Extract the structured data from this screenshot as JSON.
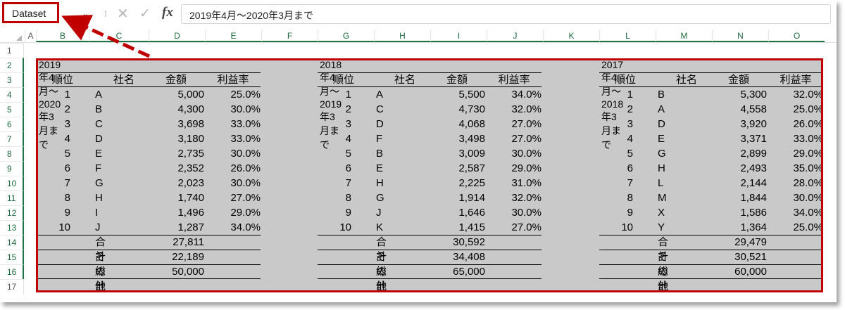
{
  "formula_bar": {
    "name_box": "Dataset",
    "formula": "2019年4月～2020年3月まで",
    "sep_glyph": "⁝",
    "cancel_glyph": "✕",
    "enter_glyph": "✓",
    "fx_label": "fx",
    "chevron_glyph": "⌄"
  },
  "columns": [
    "A",
    "B",
    "C",
    "D",
    "E",
    "F",
    "G",
    "H",
    "I",
    "J",
    "K",
    "L",
    "M",
    "N",
    "O"
  ],
  "rows": [
    "1",
    "2",
    "3",
    "4",
    "5",
    "6",
    "7",
    "8",
    "9",
    "10",
    "11",
    "12",
    "13",
    "14",
    "15",
    "16",
    "17"
  ],
  "colors": {
    "highlight": "#c00000",
    "selection_fill": "#c9c9c9",
    "header_selected": "#1e7145"
  },
  "headers": {
    "rank": "順位",
    "company": "社名",
    "amount": "金額",
    "margin": "利益率"
  },
  "summary_labels": {
    "subtotal": "合計",
    "others": "その他",
    "grand_total": "総計"
  },
  "tables": [
    {
      "title": "2019年4月～2020年3月まで",
      "rows": [
        {
          "rank": "1",
          "company": "A",
          "amount": "5,000",
          "margin": "25.0%"
        },
        {
          "rank": "2",
          "company": "B",
          "amount": "4,300",
          "margin": "30.0%"
        },
        {
          "rank": "3",
          "company": "C",
          "amount": "3,698",
          "margin": "33.0%"
        },
        {
          "rank": "4",
          "company": "D",
          "amount": "3,180",
          "margin": "33.0%"
        },
        {
          "rank": "5",
          "company": "E",
          "amount": "2,735",
          "margin": "30.0%"
        },
        {
          "rank": "6",
          "company": "F",
          "amount": "2,352",
          "margin": "26.0%"
        },
        {
          "rank": "7",
          "company": "G",
          "amount": "2,023",
          "margin": "30.0%"
        },
        {
          "rank": "8",
          "company": "H",
          "amount": "1,740",
          "margin": "27.0%"
        },
        {
          "rank": "9",
          "company": "I",
          "amount": "1,496",
          "margin": "29.0%"
        },
        {
          "rank": "10",
          "company": "J",
          "amount": "1,287",
          "margin": "34.0%"
        }
      ],
      "subtotal": "27,811",
      "others": "22,189",
      "grand_total": "50,000"
    },
    {
      "title": "2018年4月～2019年3月まで",
      "rows": [
        {
          "rank": "1",
          "company": "A",
          "amount": "5,500",
          "margin": "34.0%"
        },
        {
          "rank": "2",
          "company": "C",
          "amount": "4,730",
          "margin": "32.0%"
        },
        {
          "rank": "3",
          "company": "D",
          "amount": "4,068",
          "margin": "27.0%"
        },
        {
          "rank": "4",
          "company": "F",
          "amount": "3,498",
          "margin": "27.0%"
        },
        {
          "rank": "5",
          "company": "B",
          "amount": "3,009",
          "margin": "30.0%"
        },
        {
          "rank": "6",
          "company": "E",
          "amount": "2,587",
          "margin": "29.0%"
        },
        {
          "rank": "7",
          "company": "H",
          "amount": "2,225",
          "margin": "31.0%"
        },
        {
          "rank": "8",
          "company": "G",
          "amount": "1,914",
          "margin": "32.0%"
        },
        {
          "rank": "9",
          "company": "J",
          "amount": "1,646",
          "margin": "30.0%"
        },
        {
          "rank": "10",
          "company": "K",
          "amount": "1,415",
          "margin": "27.0%"
        }
      ],
      "subtotal": "30,592",
      "others": "34,408",
      "grand_total": "65,000"
    },
    {
      "title": "2017年4月～2018年3月まで",
      "rows": [
        {
          "rank": "1",
          "company": "B",
          "amount": "5,300",
          "margin": "32.0%"
        },
        {
          "rank": "2",
          "company": "A",
          "amount": "4,558",
          "margin": "25.0%"
        },
        {
          "rank": "3",
          "company": "D",
          "amount": "3,920",
          "margin": "26.0%"
        },
        {
          "rank": "4",
          "company": "E",
          "amount": "3,371",
          "margin": "33.0%"
        },
        {
          "rank": "5",
          "company": "G",
          "amount": "2,899",
          "margin": "29.0%"
        },
        {
          "rank": "6",
          "company": "H",
          "amount": "2,493",
          "margin": "35.0%"
        },
        {
          "rank": "7",
          "company": "L",
          "amount": "2,144",
          "margin": "28.0%"
        },
        {
          "rank": "8",
          "company": "M",
          "amount": "1,844",
          "margin": "30.0%"
        },
        {
          "rank": "9",
          "company": "X",
          "amount": "1,586",
          "margin": "34.0%"
        },
        {
          "rank": "10",
          "company": "Y",
          "amount": "1,364",
          "margin": "25.0%"
        }
      ],
      "subtotal": "29,479",
      "others": "30,521",
      "grand_total": "60,000"
    }
  ]
}
